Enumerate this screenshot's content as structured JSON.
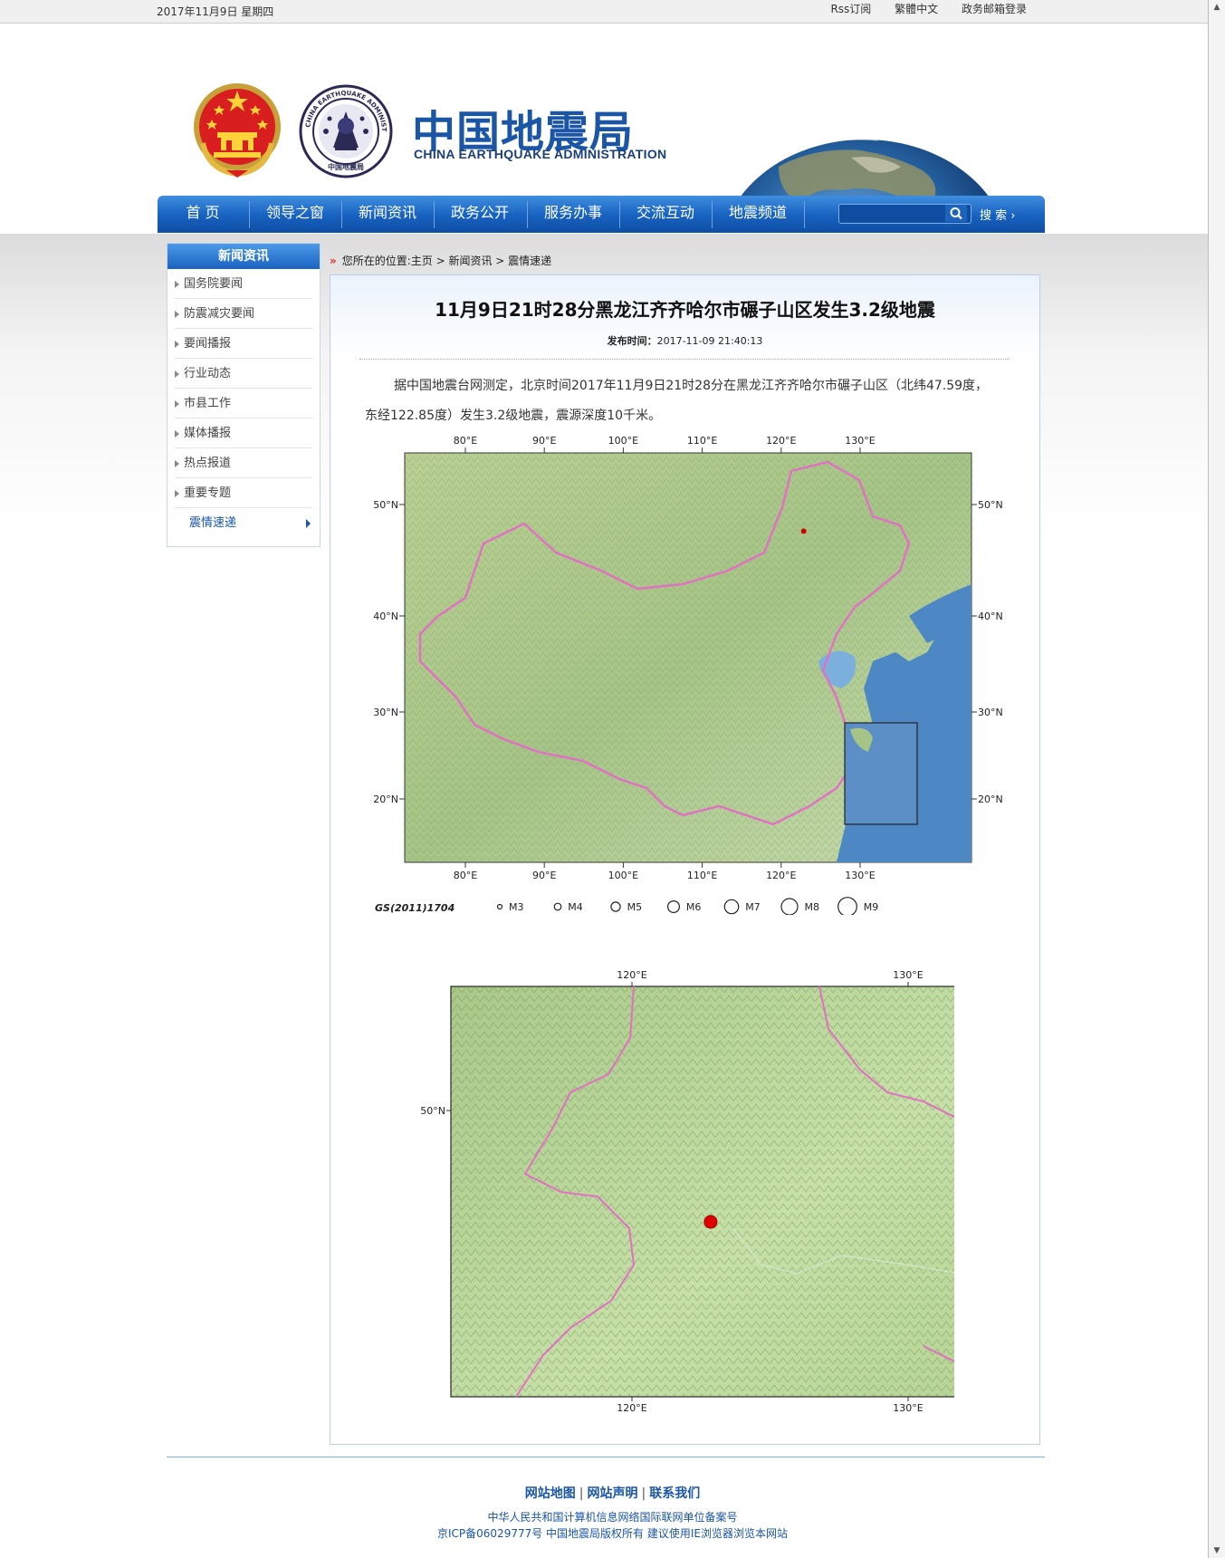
{
  "topbar": {
    "date": "2017年11月9日  星期四",
    "links": [
      "Rss订阅",
      "繁體中文",
      "政务邮箱登录"
    ]
  },
  "header": {
    "logo_cn": "中国地震局",
    "logo_en": "CHINA EARTHQUAKE ADMINISTRATION",
    "seal_text_top": "CHINA EARTHQUAKE ADMINISTRATION",
    "seal_text_bottom": "中国地震局"
  },
  "nav": {
    "items": [
      "首 页",
      "领导之窗",
      "新闻资讯",
      "政务公开",
      "服务办事",
      "交流互动",
      "地震频道"
    ],
    "search_placeholder": "",
    "search_label": "搜 索 ›"
  },
  "sidebar": {
    "title": "新闻资讯",
    "items": [
      "国务院要闻",
      "防震减灾要闻",
      "要闻播报",
      "行业动态",
      "市县工作",
      "媒体播报",
      "热点报道",
      "重要专题",
      "震情速递"
    ],
    "active_index": 8
  },
  "breadcrumb": {
    "marker": "»",
    "text": "您所在的位置:主页 > 新闻资讯 > 震情速递"
  },
  "article": {
    "title": "11月9日21时28分黑龙江齐齐哈尔市碾子山区发生3.2级地震",
    "time_label": "发布时间：",
    "time_value": "2017-11-09 21:40:13",
    "body": "据中国地震台网测定，北京时间2017年11月9日21时28分在黑龙江齐齐哈尔市碾子山区（北纬47.59度，东经122.85度）发生3.2级地震，震源深度10千米。"
  },
  "map1": {
    "top_ticks": [
      "80°E",
      "90°E",
      "100°E",
      "110°E",
      "120°E",
      "130°E"
    ],
    "left_ticks": [
      "50°N",
      "40°N",
      "30°N",
      "20°N"
    ],
    "right_ticks": [
      "50°N",
      "40°N",
      "30°N",
      "20°N"
    ],
    "bottom_ticks": [
      "80°E",
      "90°E",
      "100°E",
      "110°E",
      "120°E",
      "130°E"
    ],
    "credit": "GS(2011)1704",
    "legend": [
      "M3",
      "M4",
      "M5",
      "M6",
      "M7",
      "M8",
      "M9"
    ],
    "epicenter": {
      "lon": 122.85,
      "lat": 47.59
    },
    "colors": {
      "land": "#a9c98a",
      "sea": "#4a86c2",
      "border": "#e36fc4",
      "epicenter": "#d00000"
    }
  },
  "map2": {
    "top_ticks": [
      "120°E",
      "130°E"
    ],
    "left_ticks": [
      "50°N"
    ],
    "bottom_ticks": [
      "120°E",
      "130°E"
    ],
    "epicenter": {
      "lon": 122.85,
      "lat": 47.59
    }
  },
  "footer": {
    "links": [
      "网站地图",
      "网站声明",
      "联系我们"
    ],
    "line1": "中华人民共和国计算机信息网络国际联网单位备案号",
    "line2": "京ICP备06029777号  中国地震局版权所有  建议使用IE浏览器浏览本网站"
  }
}
